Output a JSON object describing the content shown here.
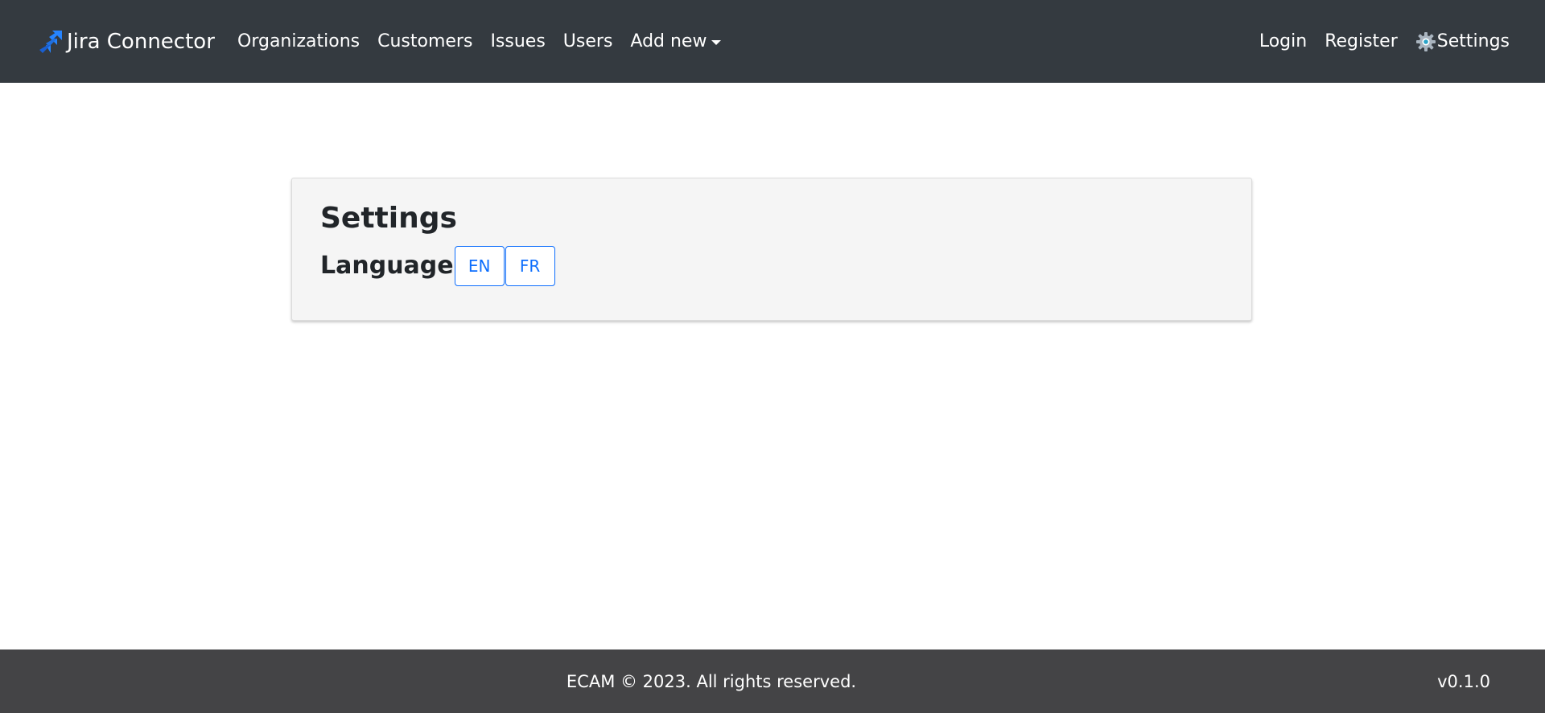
{
  "navbar": {
    "brand": "Jira Connector",
    "brand_logo_icon": "jira-logo-icon",
    "left_links": [
      "Organizations",
      "Customers",
      "Issues",
      "Users"
    ],
    "add_new": "Add new",
    "right_links": {
      "login": "Login",
      "register": "Register",
      "settings": "Settings",
      "settings_icon": "gear-icon"
    },
    "background_color": "#343a40"
  },
  "settings_card": {
    "title": "Settings",
    "language_label": "Language",
    "language_options": [
      "EN",
      "FR"
    ],
    "accent_color": "#0d6efd"
  },
  "footer": {
    "copyright": "ECAM © 2023. All rights reserved.",
    "version": "v0.1.0",
    "background_color": "#444446"
  }
}
